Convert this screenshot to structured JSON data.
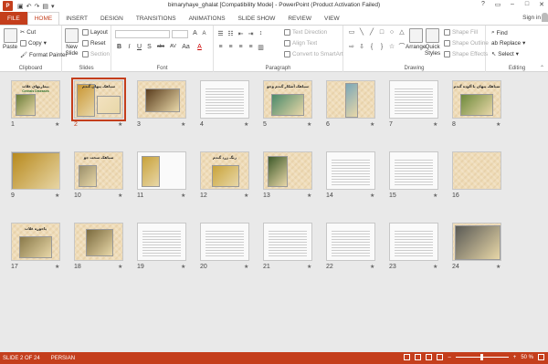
{
  "window": {
    "title": "bimaryhaye_ghalat [Compatibility Mode] - PowerPoint (Product Activation Failed)",
    "app_icon": "P",
    "help": "?",
    "sign_in": "Sign in"
  },
  "ribbon_tabs": [
    "FILE",
    "HOME",
    "INSERT",
    "DESIGN",
    "TRANSITIONS",
    "ANIMATIONS",
    "SLIDE SHOW",
    "REVIEW",
    "VIEW"
  ],
  "clipboard": {
    "paste": "Paste",
    "cut": "Cut",
    "copy": "Copy",
    "format_painter": "Format Painter",
    "label": "Clipboard"
  },
  "slides_group": {
    "new_slide": "New",
    "new_slide_2": "Slide",
    "layout": "Layout",
    "reset": "Reset",
    "section": "Section",
    "label": "Slides"
  },
  "font_group": {
    "bold": "B",
    "italic": "I",
    "underline": "U",
    "strike": "S",
    "shadow": "abc",
    "spacing": "AV",
    "case": "Aa",
    "font_color": "A",
    "label": "Font"
  },
  "paragraph_group": {
    "text_direction": "Text Direction",
    "align_text": "Align Text",
    "convert_smartart": "Convert to SmartArt",
    "label": "Paragraph"
  },
  "drawing_group": {
    "arrange": "Arrange",
    "quick_styles_1": "Quick",
    "quick_styles_2": "Styles",
    "shape_fill": "Shape Fill",
    "shape_outline": "Shape Outline",
    "shape_effects": "Shape Effects",
    "label": "Drawing"
  },
  "editing_group": {
    "find": "Find",
    "replace": "Replace",
    "select": "Select",
    "label": "Editing"
  },
  "slides": [
    {
      "n": "1",
      "title": "بیماریهای غلات",
      "sub": "Cereals Diseases"
    },
    {
      "n": "2",
      "title": "سیاهک پنهان گندم",
      "sub": ""
    },
    {
      "n": "3",
      "title": "",
      "sub": ""
    },
    {
      "n": "4",
      "title": "",
      "sub": ""
    },
    {
      "n": "5",
      "title": "سیاهک آشکار گندم وجو",
      "sub": ""
    },
    {
      "n": "6",
      "title": "",
      "sub": ""
    },
    {
      "n": "7",
      "title": "",
      "sub": ""
    },
    {
      "n": "8",
      "title": "سیاهک پنهان یا آلوده گندم",
      "sub": ""
    },
    {
      "n": "9",
      "title": "",
      "sub": ""
    },
    {
      "n": "10",
      "title": "سیاهک سخت جو",
      "sub": ""
    },
    {
      "n": "11",
      "title": "",
      "sub": ""
    },
    {
      "n": "12",
      "title": "زنگ زرد گندم",
      "sub": ""
    },
    {
      "n": "13",
      "title": "",
      "sub": ""
    },
    {
      "n": "14",
      "title": "",
      "sub": ""
    },
    {
      "n": "15",
      "title": "",
      "sub": ""
    },
    {
      "n": "16",
      "title": "",
      "sub": ""
    },
    {
      "n": "17",
      "title": "پاخوره غلات",
      "sub": ""
    },
    {
      "n": "18",
      "title": "",
      "sub": ""
    },
    {
      "n": "19",
      "title": "",
      "sub": ""
    },
    {
      "n": "20",
      "title": "",
      "sub": ""
    },
    {
      "n": "21",
      "title": "",
      "sub": ""
    },
    {
      "n": "22",
      "title": "",
      "sub": ""
    },
    {
      "n": "23",
      "title": "",
      "sub": ""
    },
    {
      "n": "24",
      "title": "",
      "sub": ""
    }
  ],
  "slide_star": "★",
  "status": {
    "slide_counter": "SLIDE 2 OF 24",
    "language": "PERSIAN",
    "zoom": "50 %",
    "zoom_level_percent": 50
  },
  "colors": {
    "accent": "#c43e1c",
    "slide_bg": "#efdcb8"
  }
}
